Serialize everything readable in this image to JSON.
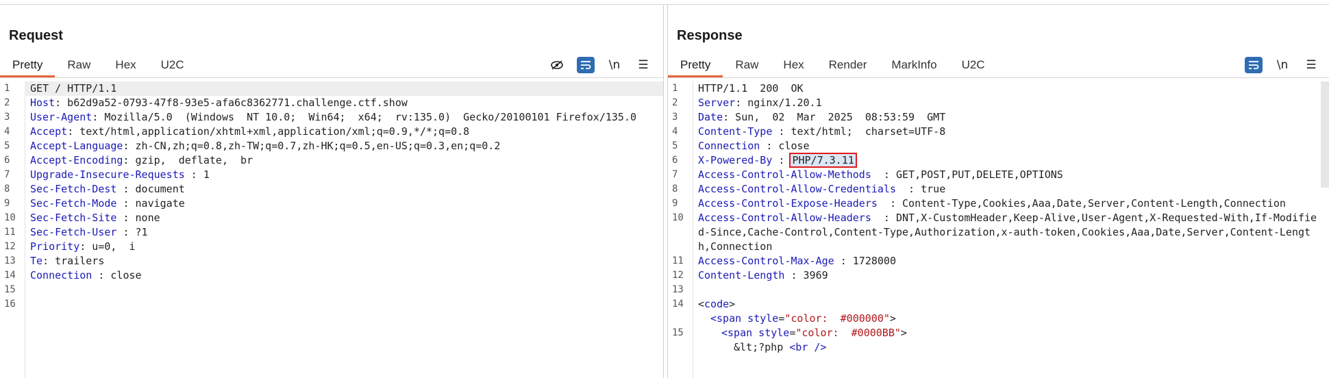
{
  "request": {
    "title": "Request",
    "tabs": [
      "Pretty",
      "Raw",
      "Hex",
      "U2C"
    ],
    "tools": {
      "hide": "⊘",
      "wrap": "≡",
      "newline": "\\n",
      "menu": "☰"
    },
    "lines": [
      {
        "n": "1",
        "k": "",
        "v": "GET / HTTP/1.1"
      },
      {
        "n": "2",
        "k": "Host",
        "v": ": b62d9a52-0793-47f8-93e5-afa6c8362771.challenge.ctf.show"
      },
      {
        "n": "3",
        "k": "User-Agent",
        "v": ": Mozilla/5.0  (Windows  NT 10.0;  Win64;  x64;  rv:135.0)  Gecko/20100101 Firefox/135.0"
      },
      {
        "n": "4",
        "k": "Accept",
        "v": ": text/html,application/xhtml+xml,application/xml;q=0.9,*/*;q=0.8"
      },
      {
        "n": "5",
        "k": "Accept-Language",
        "v": ": zh-CN,zh;q=0.8,zh-TW;q=0.7,zh-HK;q=0.5,en-US;q=0.3,en;q=0.2"
      },
      {
        "n": "6",
        "k": "Accept-Encoding",
        "v": ": gzip,  deflate,  br"
      },
      {
        "n": "7",
        "k": "Upgrade-Insecure-Requests",
        "v": " : 1"
      },
      {
        "n": "8",
        "k": "Sec-Fetch-Dest",
        "v": " : document"
      },
      {
        "n": "9",
        "k": "Sec-Fetch-Mode",
        "v": " : navigate"
      },
      {
        "n": "10",
        "k": "Sec-Fetch-Site",
        "v": " : none"
      },
      {
        "n": "11",
        "k": "Sec-Fetch-User",
        "v": " : ?1"
      },
      {
        "n": "12",
        "k": "Priority",
        "v": ": u=0,  i"
      },
      {
        "n": "13",
        "k": "Te",
        "v": ": trailers"
      },
      {
        "n": "14",
        "k": "Connection",
        "v": " : close"
      },
      {
        "n": "15",
        "k": "",
        "v": ""
      },
      {
        "n": "16",
        "k": "",
        "v": ""
      }
    ]
  },
  "response": {
    "title": "Response",
    "tabs": [
      "Pretty",
      "Raw",
      "Hex",
      "Render",
      "MarkInfo",
      "U2C"
    ],
    "tools": {
      "wrap": "≡",
      "newline": "\\n",
      "menu": "☰"
    },
    "lines": [
      {
        "n": "1",
        "k": "",
        "v": "HTTP/1.1  200  OK"
      },
      {
        "n": "2",
        "k": "Server",
        "v": ": nginx/1.20.1"
      },
      {
        "n": "3",
        "k": "Date",
        "v": ": Sun,  02  Mar  2025  08:53:59  GMT"
      },
      {
        "n": "4",
        "k": "Content-Type",
        "v": " : text/html;  charset=UTF-8"
      },
      {
        "n": "5",
        "k": "Connection",
        "v": " : close"
      },
      {
        "n": "6",
        "k": "X-Powered-By",
        "v": " : ",
        "hl": "PHP/7.3.11"
      },
      {
        "n": "7",
        "k": "Access-Control-Allow-Methods",
        "v": "  : GET,POST,PUT,DELETE,OPTIONS"
      },
      {
        "n": "8",
        "k": "Access-Control-Allow-Credentials",
        "v": "  : true"
      },
      {
        "n": "9",
        "k": "Access-Control-Expose-Headers",
        "v": "  : Content-Type,Cookies,Aaa,Date,Server,Content-Length,Connection"
      },
      {
        "n": "10",
        "k": "Access-Control-Allow-Headers",
        "v": "  : DNT,X-CustomHeader,Keep-Alive,User-Agent,X-Requested-With,If-Modified-Since,Cache-Control,Content-Type,Authorization,x-auth-token,Cookies,Aaa,Date,Server,Content-Length,Connection"
      },
      {
        "n": "11",
        "k": "Access-Control-Max-Age",
        "v": " : 1728000"
      },
      {
        "n": "12",
        "k": "Content-Length",
        "v": " : 3969"
      },
      {
        "n": "13",
        "k": "",
        "v": ""
      },
      {
        "n": "14",
        "html": "code_open"
      },
      {
        "n": "",
        "html": "span1"
      },
      {
        "n": "15",
        "html": "span2"
      },
      {
        "n": "",
        "html": "php"
      }
    ],
    "markup": {
      "code_open": [
        "<",
        "code",
        ">"
      ],
      "span1": {
        "tag": "<span",
        "attr": " style",
        "eq": "=",
        "val": "\"color:  #000000\"",
        "end": ">"
      },
      "span2": {
        "tag": "<span",
        "attr": " style",
        "eq": "=",
        "val": "\"color:  #0000BB\"",
        "end": ">"
      },
      "php": {
        "text": "&lt;?php ",
        "tag": "<br />"
      }
    }
  },
  "layout_buttons": [
    "split-horizontal",
    "split-vertical",
    "single"
  ]
}
